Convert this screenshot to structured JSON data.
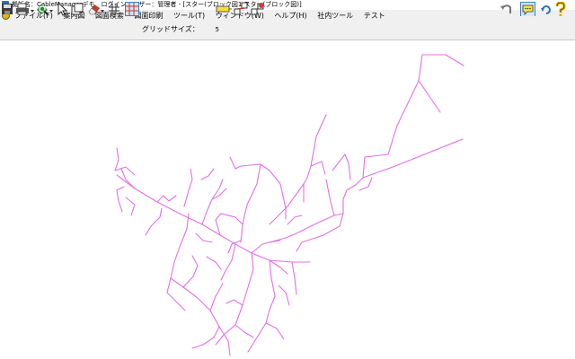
{
  "window": {
    "title": "拠訴名：CableManagerデモ　ログインユーザー：管理者 - [スター(ブロック図1.スター(ブロック図)]"
  },
  "menu": {
    "items": [
      {
        "label": "ファイル(F)"
      },
      {
        "label": "案内図"
      },
      {
        "label": "図面検索"
      },
      {
        "label": "図面印刷"
      },
      {
        "label": "ツール(T)"
      },
      {
        "label": "ウィンドウ(W)"
      },
      {
        "label": "ヘルプ(H)"
      },
      {
        "label": "社内ツール"
      },
      {
        "label": "テスト"
      }
    ]
  },
  "toolbar": {
    "grid_label": "グリッドサイズ：",
    "grid_value": "5",
    "icons": [
      "save-icon",
      "print-icon",
      "zoom-icon",
      "pointer-icon",
      "copy-icon",
      "eraser-icon",
      "crosshair-icon",
      "grid-icon",
      "measure-icon",
      "node-tool-icon",
      "node-delete-icon",
      "undo-icon",
      "chat-icon",
      "refresh-icon",
      "help-icon"
    ]
  },
  "colors": {
    "network_line": "#e36fe3",
    "accent": "#2d6fb4"
  }
}
